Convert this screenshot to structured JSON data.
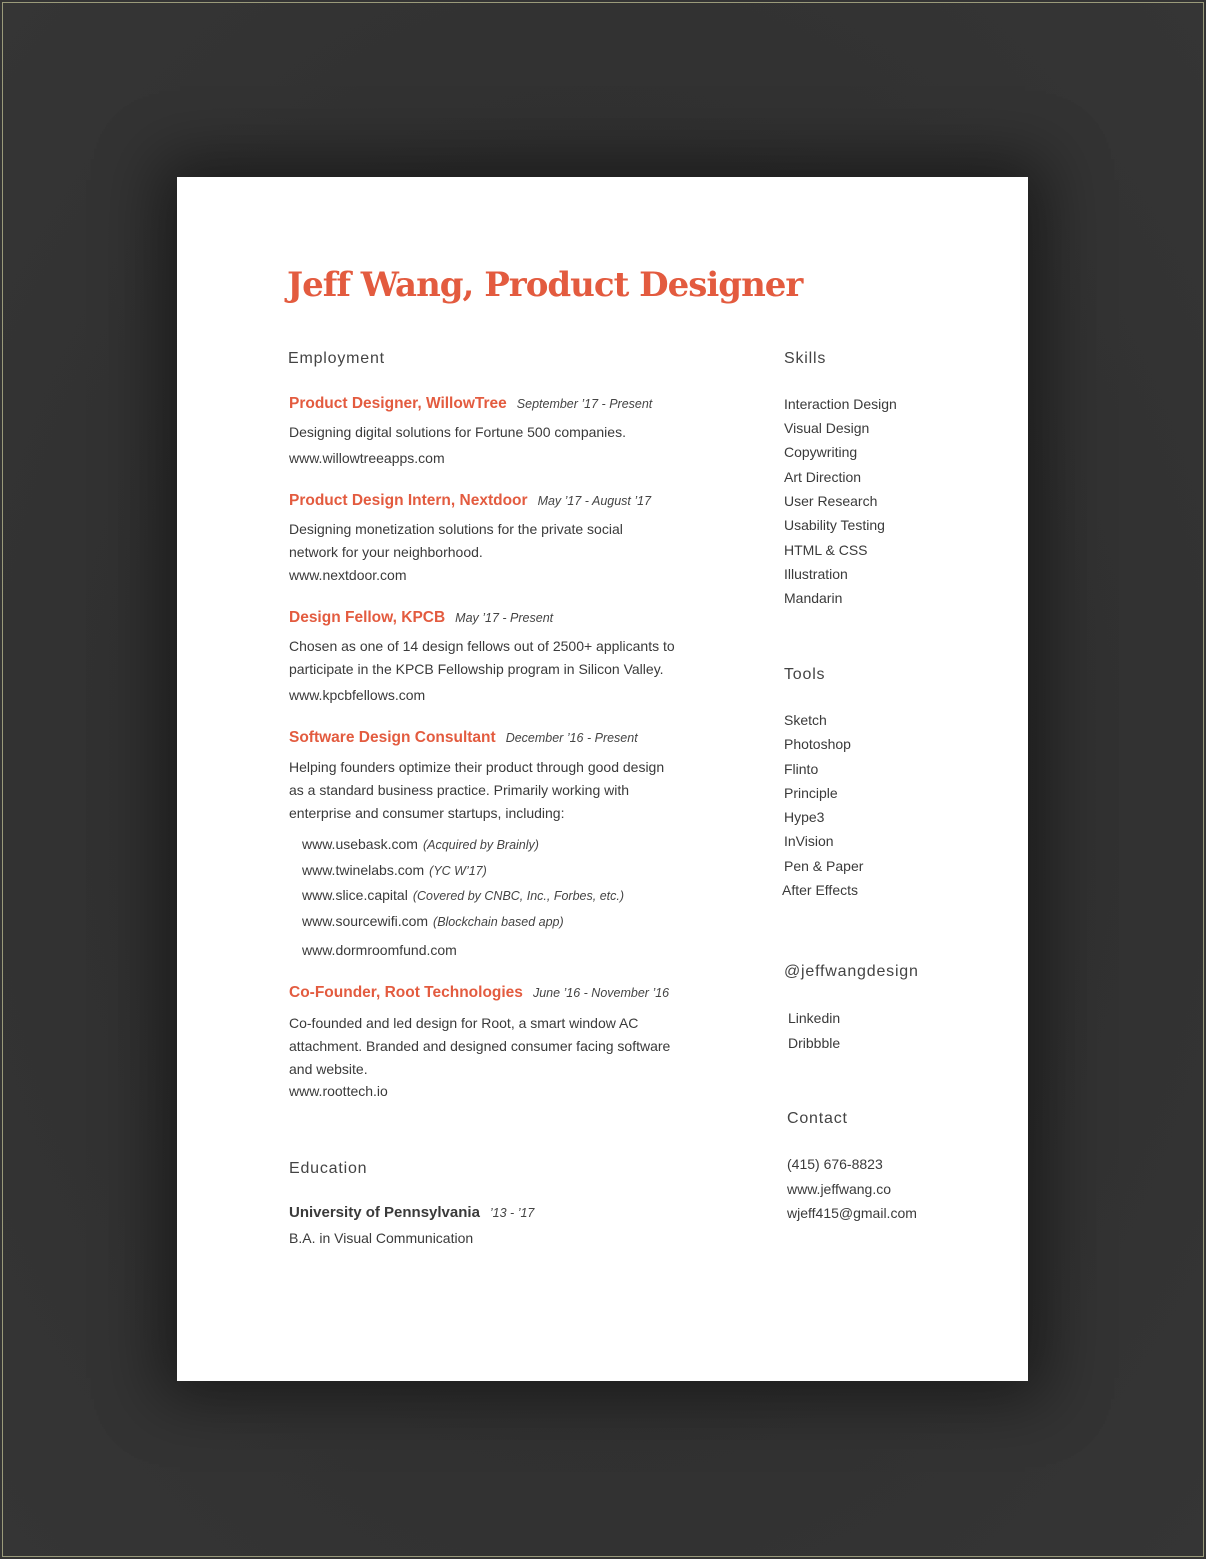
{
  "header": {
    "title": "Jeff Wang, Product Designer"
  },
  "employment": {
    "heading": "Employment",
    "jobs": [
      {
        "title": "Product Designer, WillowTree",
        "date": "September ’17 - Present",
        "description": "Designing digital solutions for Fortune 500 companies.",
        "url": "www.willowtreeapps.com"
      },
      {
        "title": "Product Design Intern, Nextdoor",
        "date": "May ’17 - August ’17",
        "description_lines": [
          "Designing monetization solutions for the private social",
          "network for your neighborhood."
        ],
        "url": "www.nextdoor.com"
      },
      {
        "title": "Design Fellow, KPCB",
        "date": "May ’17 - Present",
        "description_lines": [
          "Chosen as one of 14 design fellows out of 2500+ applicants to",
          "participate in the KPCB Fellowship program in Silicon Valley."
        ],
        "url": "www.kpcbfellows.com"
      },
      {
        "title": "Software Design Consultant",
        "date": "December ’16 - Present",
        "description_lines": [
          "Helping founders optimize their product through good design",
          "as a standard business practice. Primarily working with",
          "enterprise and consumer startups, including:"
        ],
        "links": [
          {
            "url": "www.usebask.com",
            "note": "(Acquired by Brainly)"
          },
          {
            "url": "www.twinelabs.com",
            "note": "(YC W’17)"
          },
          {
            "url": "www.slice.capital",
            "note": "(Covered by CNBC, Inc., Forbes, etc.)"
          },
          {
            "url": "www.sourcewifi.com",
            "note": "(Blockchain based app)"
          },
          {
            "url": "www.dormroomfund.com",
            "note": ""
          }
        ]
      },
      {
        "title": "Co-Founder, Root Technologies",
        "date": "June ’16 - November ’16",
        "description_lines": [
          "Co-founded and led design for Root, a smart window AC",
          "attachment. Branded and designed consumer facing software",
          "and website."
        ],
        "url": "www.roottech.io"
      }
    ]
  },
  "education": {
    "heading": "Education",
    "school": "University of Pennsylvania",
    "years": "’13 - ’17",
    "degree": "B.A. in Visual Communication"
  },
  "skills": {
    "heading": "Skills",
    "items": [
      "Interaction Design",
      "Visual Design",
      "Copywriting",
      "Art Direction",
      "User Research",
      "Usability Testing",
      "HTML & CSS",
      "Illustration",
      "Mandarin"
    ]
  },
  "tools": {
    "heading": "Tools",
    "items": [
      "Sketch",
      "Photoshop",
      "Flinto",
      "Principle",
      "Hype3",
      "InVision",
      "Pen & Paper",
      "After Effects"
    ]
  },
  "social": {
    "heading": "@jeffwangdesign",
    "items": [
      "Linkedin",
      "Dribbble"
    ]
  },
  "contact": {
    "heading": "Contact",
    "phone": "(415) 676-8823",
    "website": "www.jeffwang.co",
    "email": "wjeff415@gmail.com"
  }
}
